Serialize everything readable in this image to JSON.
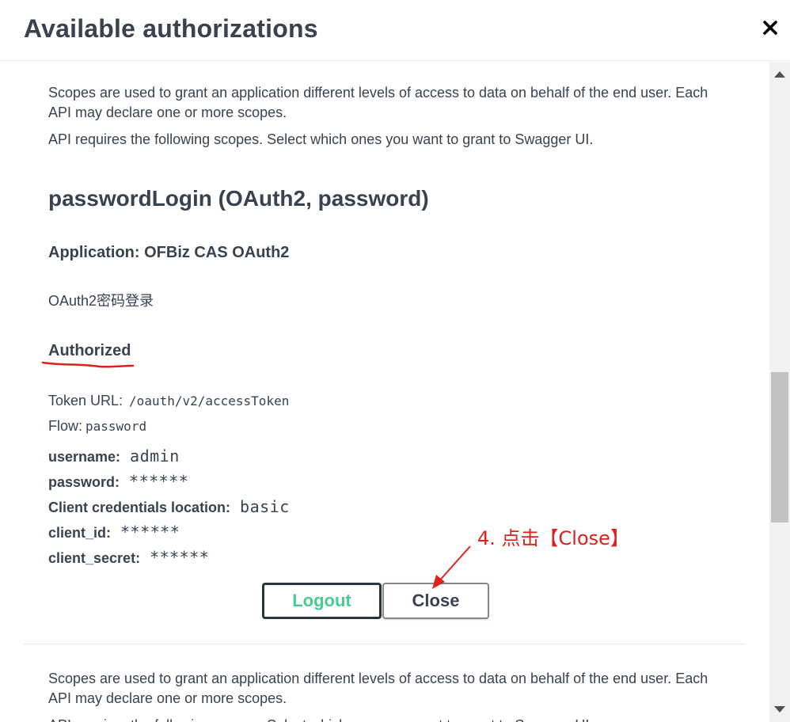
{
  "modal": {
    "title": "Available authorizations",
    "close_glyph": "✕"
  },
  "section1": {
    "scopes_desc": "Scopes are used to grant an application different levels of access to data on behalf of the end user. Each API may declare one or more scopes.",
    "scopes_required": "API requires the following scopes. Select which ones you want to grant to Swagger UI.",
    "scheme_title": "passwordLogin (OAuth2, password)",
    "application": "Application: OFBiz CAS OAuth2",
    "description": "OAuth2密码登录",
    "status": "Authorized",
    "token_url_label": "Token URL:",
    "token_url": "/oauth/v2/accessToken",
    "flow_label": "Flow:",
    "flow": "password",
    "fields": [
      {
        "label": "username:",
        "value": "admin"
      },
      {
        "label": "password:",
        "value": "******"
      },
      {
        "label": "Client credentials location:",
        "value": "basic"
      },
      {
        "label": "client_id:",
        "value": "******"
      },
      {
        "label": "client_secret:",
        "value": "******"
      }
    ],
    "logout_label": "Logout",
    "close_label": "Close"
  },
  "section2": {
    "scopes_desc": "Scopes are used to grant an application different levels of access to data on behalf of the end user. Each API may declare one or more scopes.",
    "scopes_required": "API requires the following scopes. Select which ones you want to grant to Swagger UI."
  },
  "annotation": {
    "text": "4. 点击【Close】",
    "color": "#e0201b"
  },
  "colors": {
    "text": "#3b4151",
    "logout_green": "#49cc90",
    "logout_border": "#26363a"
  },
  "icons": {
    "close": "close-icon",
    "scroll_up": "scroll-up-arrow-icon",
    "scroll_down": "scroll-down-arrow-icon"
  }
}
